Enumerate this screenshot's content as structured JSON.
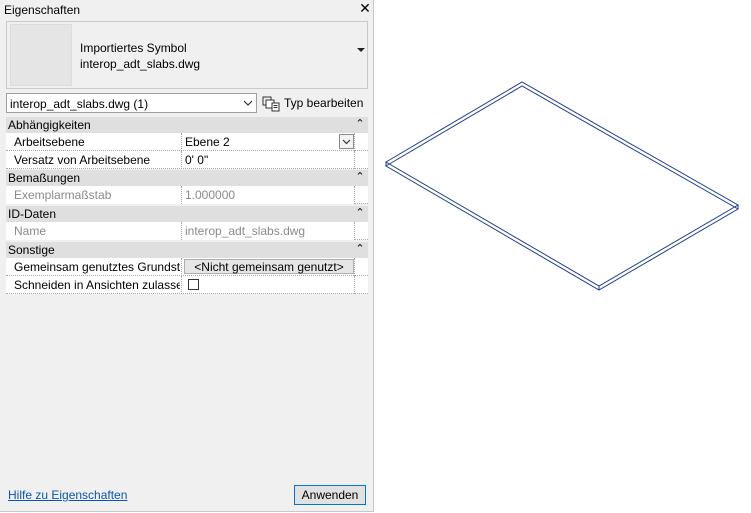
{
  "window": {
    "title": "Eigenschaften",
    "close_glyph": "✕"
  },
  "preview": {
    "line1": "Importiertes Symbol",
    "line2": "interop_adt_slabs.dwg"
  },
  "type_selector": {
    "value": "interop_adt_slabs.dwg (1)",
    "edit_label": "Typ bearbeiten"
  },
  "categories": [
    {
      "label": "Abhängigkeiten",
      "toggle": "⌃"
    },
    {
      "label": "Bemaßungen",
      "toggle": "⌃"
    },
    {
      "label": "ID-Daten",
      "toggle": "⌃"
    },
    {
      "label": "Sonstige",
      "toggle": "⌃"
    }
  ],
  "rows": {
    "arbeitsebene": {
      "name": "Arbeitsebene",
      "value": "Ebene 2"
    },
    "versatz": {
      "name": "Versatz von Arbeitsebene",
      "value": "0'  0\""
    },
    "massstab": {
      "name": "Exemplarmaßstab",
      "value": "1.000000"
    },
    "name": {
      "name": "Name",
      "value": "interop_adt_slabs.dwg"
    },
    "gemeinsam": {
      "name": "Gemeinsam genutztes Grundstück",
      "value": "<Nicht gemeinsam genutzt>"
    },
    "schneiden": {
      "name": "Schneiden in Ansichten zulassen",
      "checked": false
    }
  },
  "footer": {
    "help_link": "Hilfe zu Eigenschaften",
    "apply_label": "Anwenden"
  },
  "colors": {
    "link": "#0b56b2",
    "slab_outline": "#1f3f8f",
    "accent": "#0078d7"
  }
}
